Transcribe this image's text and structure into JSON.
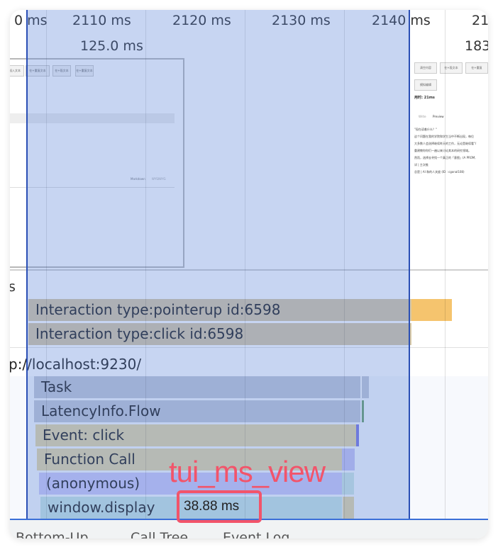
{
  "ruler": {
    "ticks": [
      "0 ms",
      "2110 ms",
      "2120 ms",
      "2130 ms",
      "2140 ms",
      "21"
    ],
    "selection_duration": "125.0 ms",
    "right_duration": "183"
  },
  "thumbnails": {
    "left_buttons": [
      "插入文本",
      "在+重复文本",
      "在+段文本",
      "在+重复文本"
    ],
    "left_footer": [
      "Markdown",
      "WYSIWYG"
    ],
    "right_buttons": [
      "清空内容",
      "在+段文本",
      "在+重复"
    ],
    "right_button2": "模拟编辑",
    "right_time": "用时: 21ms",
    "right_tabs": [
      "Write",
      "Preview"
    ],
    "right_lines": [
      "\"现在读着什么？\"",
      "这个问题在我的学院和学生当中不断出现，每位",
      "大多数人会选择继续昨天的工作，无论是继续看\"/",
      "重建教你你们一遍以来讨论其本的研究领域。",
      "然而，选择去寻找一个真正的「意图」(A PROM,",
      "详 | 主次推",
      "总是 | AI 和的人关度 (ID : cgonal108)"
    ]
  },
  "interactions": {
    "section_label": "s",
    "rows": [
      "Interaction type:pointerup id:6598",
      "Interaction type:click id:6598"
    ]
  },
  "main_thread": {
    "url_label": "p://localhost:9230/",
    "flame": [
      "Task",
      "LatencyInfo.Flow",
      "Event: click",
      "Function Call",
      "(anonymous)",
      "window.display"
    ]
  },
  "annotation": {
    "label": "tui_ms_view",
    "duration": "38.88 ms"
  },
  "footer_tabs": [
    "Bottom-Up",
    "Call Tree",
    "Event Log"
  ],
  "colors": {
    "selection": "#c8d5ef",
    "task": "#a0aec8",
    "script": "#b8ad88",
    "anonymous": "#a8a6e6",
    "display": "#a3cbca",
    "interaction": "#c0ae8c",
    "interaction_tail": "#f5c46e",
    "annotation": "#f2546a"
  }
}
